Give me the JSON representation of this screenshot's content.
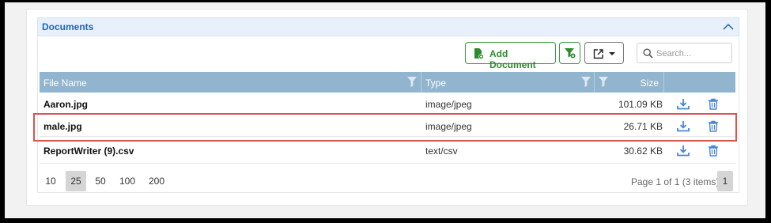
{
  "panel": {
    "title": "Documents"
  },
  "toolbar": {
    "add_label": "Add Document",
    "search_placeholder": "Search..."
  },
  "grid": {
    "columns": [
      "File Name",
      "Type",
      "Size"
    ],
    "rows": [
      {
        "name": "Aaron.jpg",
        "type": "image/jpeg",
        "size": "101.09 KB"
      },
      {
        "name": "male.jpg",
        "type": "image/jpeg",
        "size": "26.71 KB"
      },
      {
        "name": "ReportWriter (9).csv",
        "type": "text/csv",
        "size": "30.62 KB"
      }
    ]
  },
  "pager": {
    "sizes": [
      "10",
      "25",
      "50",
      "100",
      "200"
    ],
    "selected_size": "25",
    "info": "Page 1 of 1 (3 items)",
    "current_page": "1"
  },
  "colors": {
    "accent_blue": "#1a66c2",
    "header_bg": "#91b4cf",
    "green": "#2e8b2e",
    "highlight": "#d9534f",
    "icon_blue": "#4a86d8"
  }
}
